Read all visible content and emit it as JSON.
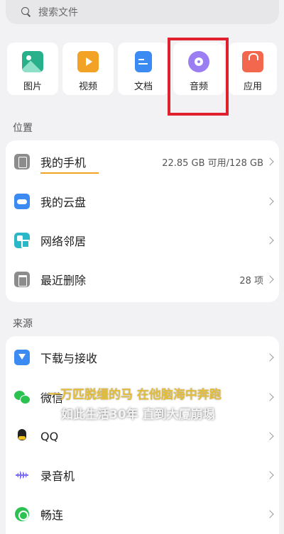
{
  "search": {
    "placeholder": "搜索文件"
  },
  "categories": [
    {
      "label": "图片",
      "icon": "picture-icon",
      "color": "#27b08a"
    },
    {
      "label": "视频",
      "icon": "video-icon",
      "color": "#f2a224"
    },
    {
      "label": "文档",
      "icon": "document-icon",
      "color": "#3c8bf2"
    },
    {
      "label": "音频",
      "icon": "audio-icon",
      "color": "#9a7ef2"
    },
    {
      "label": "应用",
      "icon": "app-bag-icon",
      "color": "#f2674e"
    }
  ],
  "location": {
    "title": "位置",
    "items": [
      {
        "label": "我的手机",
        "value": "22.85 GB 可用/128 GB",
        "icon": "phone-icon"
      },
      {
        "label": "我的云盘",
        "value": "",
        "icon": "cloud-icon"
      },
      {
        "label": "网络邻居",
        "value": "",
        "icon": "network-icon"
      },
      {
        "label": "最近删除",
        "value": "28 项",
        "icon": "trash-icon"
      }
    ]
  },
  "source": {
    "title": "来源",
    "items": [
      {
        "label": "下载与接收",
        "icon": "download-icon"
      },
      {
        "label": "微信",
        "icon": "wechat-icon"
      },
      {
        "label": "QQ",
        "icon": "qq-icon"
      },
      {
        "label": "录音机",
        "icon": "recorder-icon"
      },
      {
        "label": "畅连",
        "icon": "changlian-icon"
      }
    ]
  },
  "subtitles": {
    "line1": "一万匹脱缰的马 在他脑海中奔跑",
    "line2": "如此生活30年 直到大厦崩塌"
  },
  "colors": {
    "highlight": "#e0202c",
    "accent": "#f2a224"
  }
}
